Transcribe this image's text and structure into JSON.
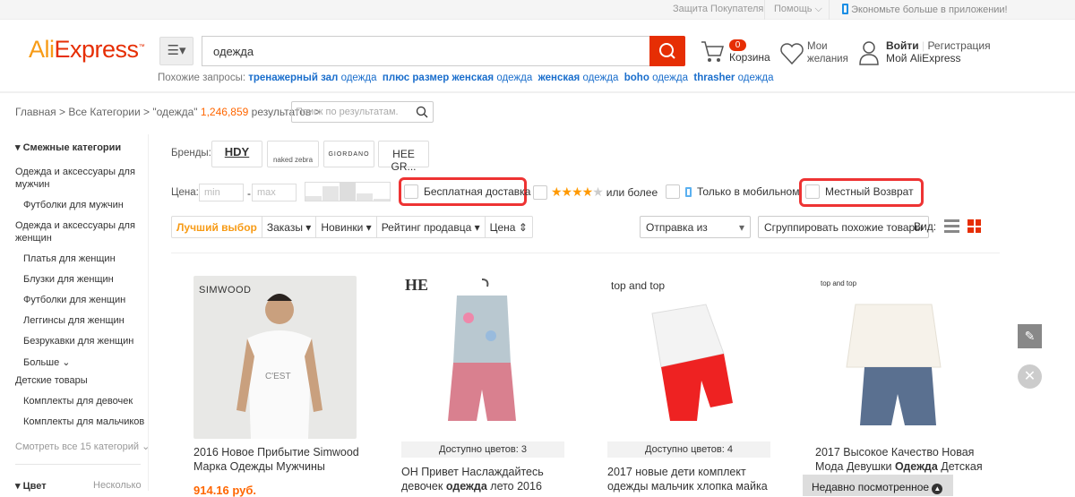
{
  "topbar": {
    "buyer_protection": "Защита Покупателя",
    "help": "Помощь",
    "app": "Экономьте больше в приложении!"
  },
  "header": {
    "logo": "AliExpress",
    "search_value": "одежда",
    "cart_count": "0",
    "cart_label": "Корзина",
    "wishlist_line1": "Мои",
    "wishlist_line2": "желания",
    "login": "Войти",
    "register": "Регистрация",
    "my_account": "Мой AliExpress"
  },
  "related": {
    "label": "Похожие запросы:",
    "items": [
      {
        "bold": "тренажерный зал",
        "rest": "одежда"
      },
      {
        "bold": "плюс размер женская",
        "rest": "одежда"
      },
      {
        "bold": "женская",
        "rest": "одежда"
      },
      {
        "bold": "boho",
        "rest": "одежда"
      },
      {
        "bold": "thrasher",
        "rest": "одежда"
      }
    ]
  },
  "breadcrumb": {
    "home": "Главная",
    "all": "Все Категории",
    "query": "\"одежда\"",
    "count": "1,246,859",
    "results": "результатов",
    "search_placeholder": "Поиск по результатам."
  },
  "sidebar": {
    "title": "Смежные категории",
    "items": [
      "Одежда и аксессуары для",
      "мужчин",
      "Футболки для мужчин",
      "Одежда и аксессуары для",
      "женщин",
      "Платья для женщин",
      "Блузки для женщин",
      "Футболки для женщин",
      "Леггинсы для женщин",
      "Безрукавки для женщин",
      "Больше",
      "Детские товары",
      "Комплекты для девочек",
      "Комплекты для мальчиков",
      "Смотреть все 15 категорий"
    ],
    "color_title": "Цвет",
    "color_value": "Несколько"
  },
  "filters": {
    "brands_label": "Бренды:",
    "brands": [
      "HDY",
      "naked zebra",
      "GIORDANO",
      "HEE GR..."
    ],
    "price_label": "Цена:",
    "min": "min",
    "max": "max",
    "free_shipping": "Бесплатная доставка",
    "rating_more": "или более",
    "mobile_only": "Только в мобильном",
    "local_return": "Местный Возврат"
  },
  "sort": {
    "best": "Лучший выбор",
    "orders": "Заказы",
    "new": "Новинки",
    "seller_rating": "Рейтинг продавца",
    "price": "Цена",
    "ship_from": "Отправка из",
    "group": "Сгруппировать похожие товары",
    "view": "Вид:"
  },
  "products": [
    {
      "brand": "SIMWOOD",
      "colors": "",
      "title": "2016 Новое Прибытие Simwood Марка Одежды Мужчины",
      "price": "914.16 руб."
    },
    {
      "brand": "HE",
      "colors": "Доступно цветов: 3",
      "title_a": "ОН Привет Наслаждайтесь девочек ",
      "title_b": "одежда",
      "title_c": " лето 2016"
    },
    {
      "brand": "top and top",
      "colors": "Доступно цветов: 4",
      "title": "2017 новые дети комплект одежды мальчик хлопка майка"
    },
    {
      "brand": "top and top",
      "colors": "",
      "title_a": "2017 Высокое Качество Новая Мода Девушки ",
      "title_b": "Одежда",
      "title_c": " Детская"
    }
  ],
  "recently_viewed": "Недавно посмотренное",
  "colors": {
    "accent": "#e62e04",
    "link": "#1a6ecc",
    "orange": "#f79b16"
  }
}
